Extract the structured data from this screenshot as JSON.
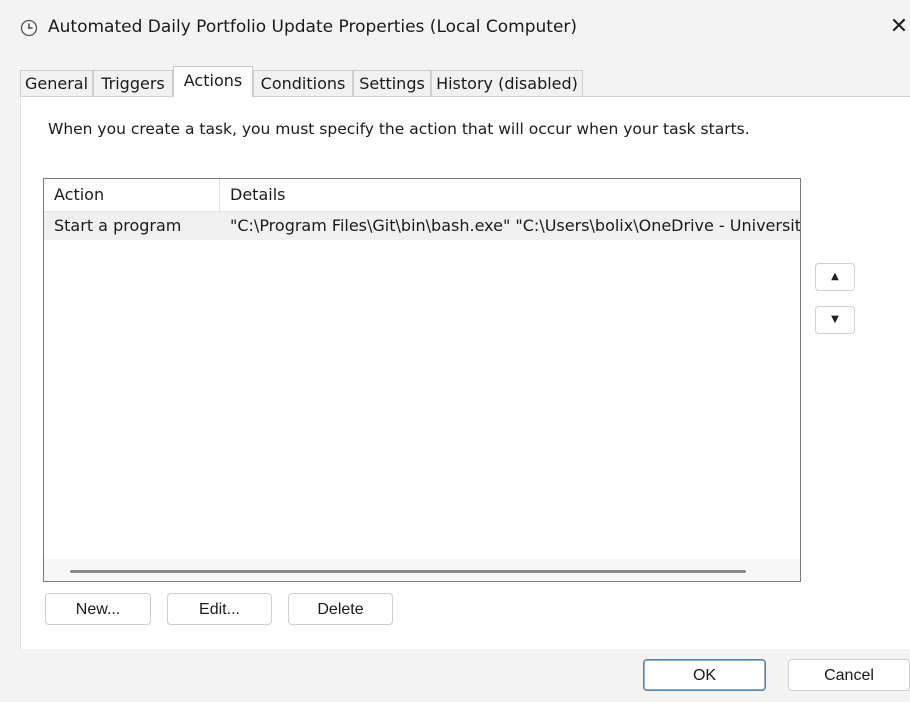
{
  "window": {
    "title": "Automated Daily Portfolio Update Properties (Local Computer)",
    "close_glyph": "✕"
  },
  "tabs": [
    {
      "label": "General"
    },
    {
      "label": "Triggers"
    },
    {
      "label": "Actions"
    },
    {
      "label": "Conditions"
    },
    {
      "label": "Settings"
    },
    {
      "label": "History (disabled)"
    }
  ],
  "active_tab": "Actions",
  "actions_panel": {
    "instructions": "When you create a task, you must specify the action that will occur when your task starts.",
    "columns": {
      "action": "Action",
      "details": "Details"
    },
    "rows": [
      {
        "action": "Start a program",
        "details": "\"C:\\Program Files\\Git\\bin\\bash.exe\" \"C:\\Users\\bolix\\OneDrive - Universita"
      }
    ],
    "move_up_glyph": "▲",
    "move_down_glyph": "▼",
    "buttons": {
      "new": "New...",
      "edit": "Edit...",
      "delete": "Delete"
    }
  },
  "footer": {
    "ok": "OK",
    "cancel": "Cancel"
  },
  "colors": {
    "dialog_bg": "#f3f3f3",
    "panel_bg": "#ffffff",
    "selected_row": "#f0f0f0",
    "default_button_border": "#5b7fa6"
  },
  "icons": {
    "title": "clock-icon",
    "close": "close-icon",
    "move_up": "triangle-up-icon",
    "move_down": "triangle-down-icon"
  }
}
